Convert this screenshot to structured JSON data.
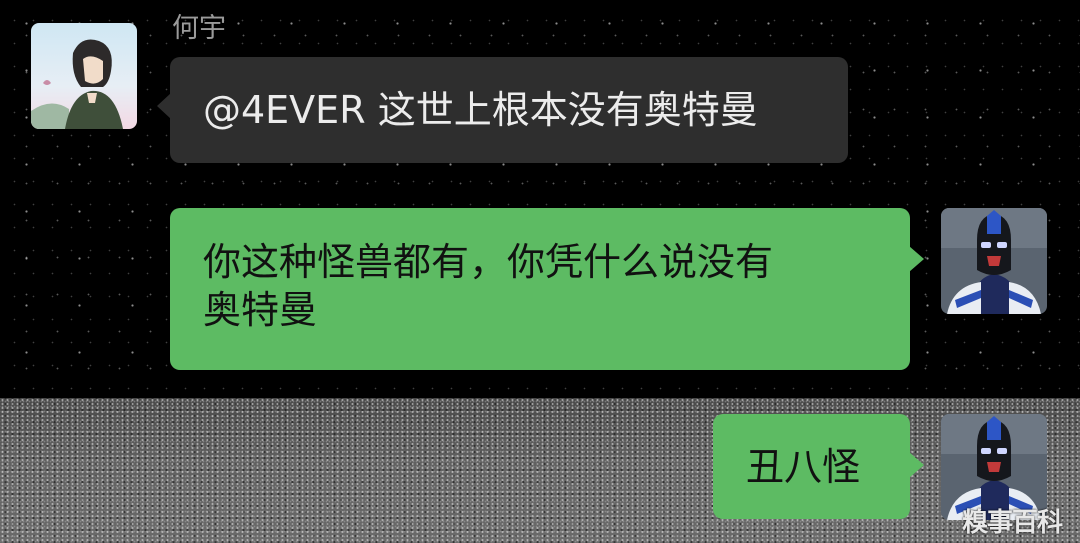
{
  "chat": {
    "messages": [
      {
        "sender": "何宇",
        "direction": "incoming",
        "mention": "@4EVER",
        "text": "这世上根本没有奥特曼"
      },
      {
        "direction": "outgoing",
        "line1": "你这种怪兽都有，你凭什么说没有",
        "line2": "奥特曼"
      },
      {
        "direction": "outgoing",
        "text": "丑八怪"
      }
    ]
  },
  "watermark": "糗事百科",
  "colors": {
    "background": "#000000",
    "incoming_bubble": "#2e2e2e",
    "outgoing_bubble": "#5dbb63",
    "sender_name": "#9a9a9a"
  },
  "icons": {
    "incoming_avatar": "anime-girl-avatar",
    "outgoing_avatar": "masked-hero-avatar"
  }
}
